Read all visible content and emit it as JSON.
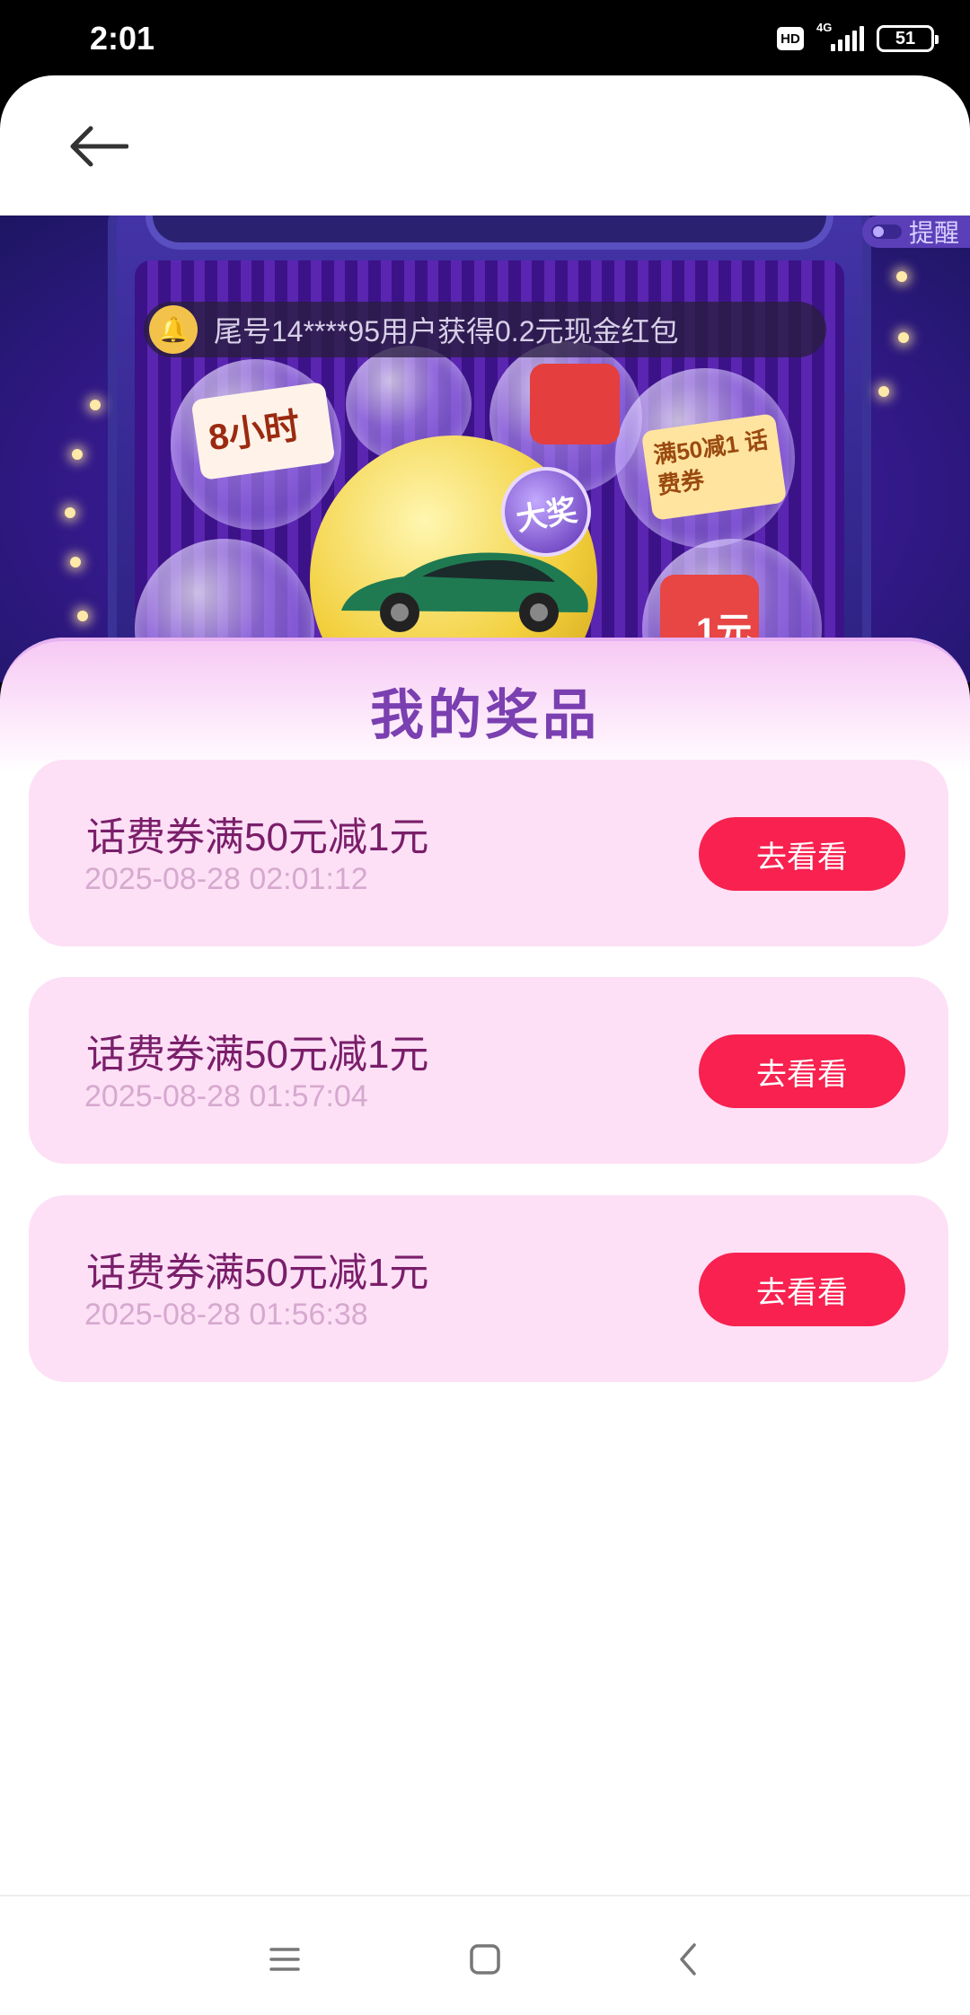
{
  "status_bar": {
    "time": "2:01",
    "hd": "HD",
    "network": "4G",
    "battery": "51"
  },
  "header": {
    "back_icon": "arrow-left-icon"
  },
  "banner": {
    "notice": "尾号14****95用户获得0.2元现金红包",
    "remind_label": "提醒",
    "card_8h": "8小时",
    "coupon_50": "满50减1 话费券",
    "badge_big": "大奖",
    "red_box_value": "1元"
  },
  "sheet": {
    "title": "我的奖品",
    "prizes": [
      {
        "name": "话费券满50元减1元",
        "time": "2025-08-28 02:01:12",
        "button": "去看看"
      },
      {
        "name": "话费券满50元减1元",
        "time": "2025-08-28 01:57:04",
        "button": "去看看"
      },
      {
        "name": "话费券满50元减1元",
        "time": "2025-08-28 01:56:38",
        "button": "去看看"
      }
    ]
  },
  "nav_bar": {
    "menu_icon": "menu-icon",
    "home_icon": "home-square-icon",
    "back_icon": "back-chevron-icon"
  },
  "colors": {
    "accent": "#f8214f",
    "title": "#7a3fb0",
    "card_bg": "#fde0f6",
    "prize_name": "#7a1e6a",
    "prize_time": "#d6a9cf"
  }
}
